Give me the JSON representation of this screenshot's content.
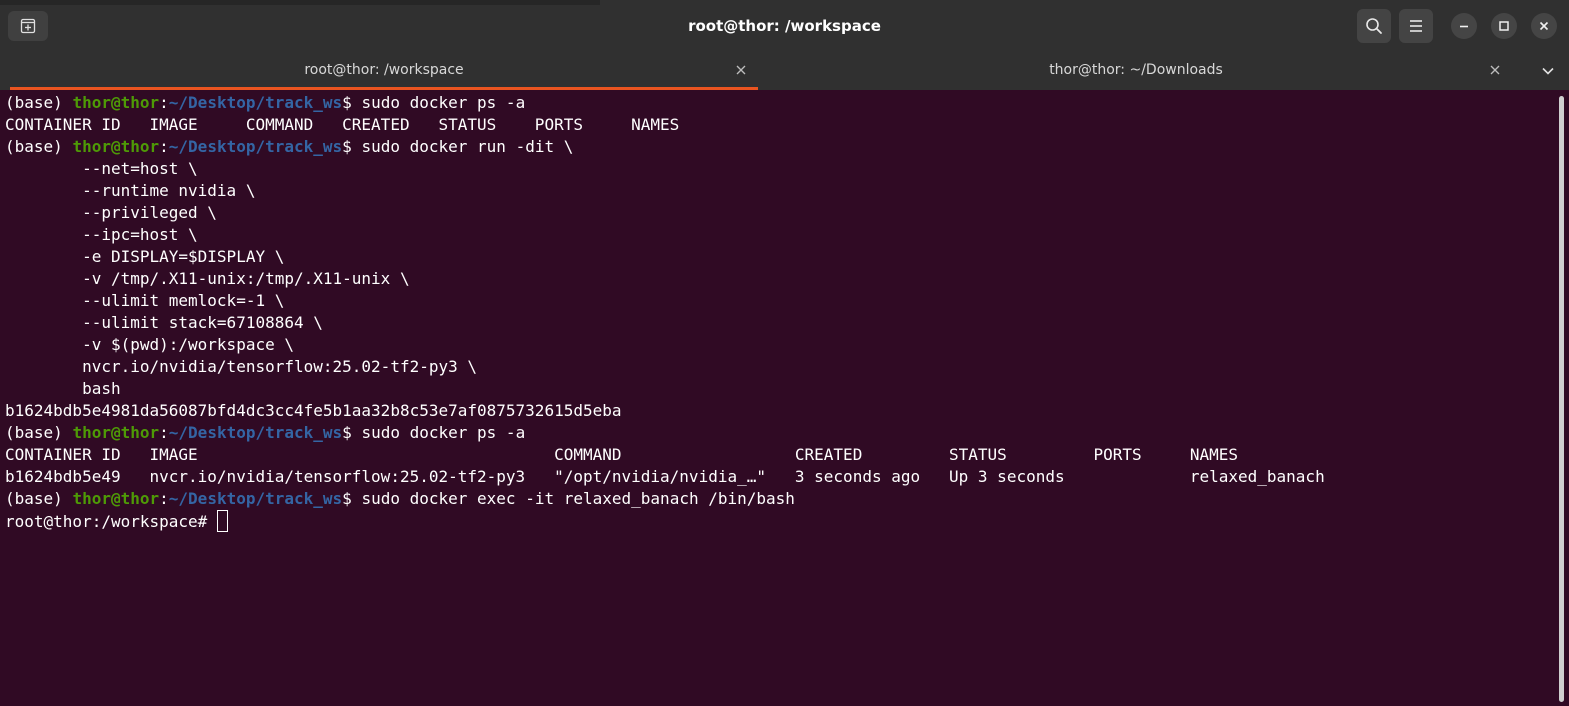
{
  "window": {
    "title": "root@thor: /workspace"
  },
  "tabs": [
    {
      "label": "root@thor: /workspace",
      "active": true
    },
    {
      "label": "thor@thor: ~/Downloads",
      "active": false
    }
  ],
  "icons": {
    "new_tab": "new-tab-icon",
    "search": "search-icon",
    "menu": "hamburger-menu-icon",
    "minimize": "minimize-icon",
    "maximize": "maximize-icon",
    "close": "close-icon",
    "tab_close": "close-icon",
    "tabs_menu": "chevron-down-icon"
  },
  "colors": {
    "terminal_bg": "#300a24",
    "user_host": "#4e9a06",
    "path": "#3465a4",
    "accent": "#e95420"
  },
  "terminal": {
    "prompt": {
      "env": "(base) ",
      "user_host": "thor@thor",
      "sep": ":",
      "path": "~/Desktop/track_ws",
      "symbol": "$ "
    },
    "lines": [
      {
        "type": "prompt",
        "cmd": "sudo docker ps -a"
      },
      {
        "type": "out",
        "text": "CONTAINER ID   IMAGE     COMMAND   CREATED   STATUS    PORTS     NAMES"
      },
      {
        "type": "prompt",
        "cmd": "sudo docker run -dit \\"
      },
      {
        "type": "out",
        "text": "        --net=host \\"
      },
      {
        "type": "out",
        "text": "        --runtime nvidia \\"
      },
      {
        "type": "out",
        "text": "        --privileged \\"
      },
      {
        "type": "out",
        "text": "        --ipc=host \\"
      },
      {
        "type": "out",
        "text": "        -e DISPLAY=$DISPLAY \\"
      },
      {
        "type": "out",
        "text": "        -v /tmp/.X11-unix:/tmp/.X11-unix \\"
      },
      {
        "type": "out",
        "text": "        --ulimit memlock=-1 \\"
      },
      {
        "type": "out",
        "text": "        --ulimit stack=67108864 \\"
      },
      {
        "type": "out",
        "text": "        -v $(pwd):/workspace \\"
      },
      {
        "type": "out",
        "text": "        nvcr.io/nvidia/tensorflow:25.02-tf2-py3 \\"
      },
      {
        "type": "out",
        "text": "        bash"
      },
      {
        "type": "out",
        "text": "b1624bdb5e4981da56087bfd4dc3cc4fe5b1aa32b8c53e7af0875732615d5eba"
      },
      {
        "type": "prompt",
        "cmd": "sudo docker ps -a"
      },
      {
        "type": "out",
        "text": "CONTAINER ID   IMAGE                                     COMMAND                  CREATED         STATUS         PORTS     NAMES"
      },
      {
        "type": "out",
        "text": "b1624bdb5e49   nvcr.io/nvidia/tensorflow:25.02-tf2-py3   \"/opt/nvidia/nvidia_…\"   3 seconds ago   Up 3 seconds             relaxed_banach"
      },
      {
        "type": "prompt",
        "cmd": "sudo docker exec -it relaxed_banach /bin/bash"
      },
      {
        "type": "root",
        "text": "root@thor:/workspace# "
      }
    ]
  }
}
